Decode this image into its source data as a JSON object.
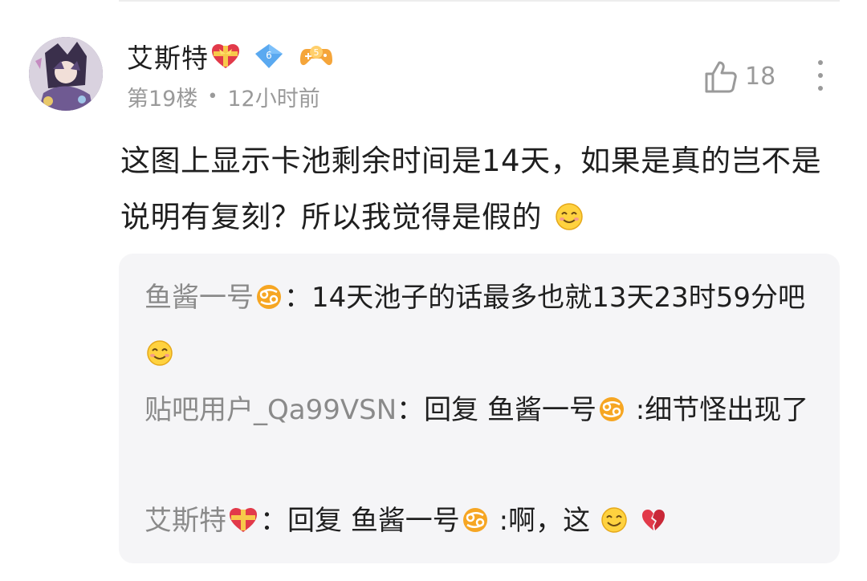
{
  "post": {
    "username": "艾斯特",
    "level": "6",
    "floor": "第19楼",
    "separator": "•",
    "time_ago": "12小时前",
    "like_count": "18",
    "content": "这图上显示卡池剩余时间是14天，如果是真的岂不是说明有复刻？所以我觉得是假的"
  },
  "replies": [
    {
      "name": "鱼酱一号",
      "colon": "：",
      "text": "14天池子的话最多也就13天23时59分吧"
    },
    {
      "name": "贴吧用户_Qa99VSN",
      "colon": "：",
      "prefix": "回复 ",
      "target": "鱼酱一号",
      "text": " :细节怪出现了"
    },
    {
      "name": "艾斯特",
      "colon": "：",
      "prefix": "回复 ",
      "target": "鱼酱一号",
      "text": " :啊，这"
    }
  ],
  "icons": {
    "heart_badge": "heart-bow-icon",
    "level_badge": "level-diamond-icon",
    "game_badge": "game-controller-icon",
    "like": "thumb-up-icon",
    "more": "more-vertical-icon",
    "emoji": "smile-emoji-icon",
    "cancer": "cancer-zodiac-icon",
    "broken_heart": "broken-heart-icon"
  },
  "colors": {
    "text_primary": "#1f1f1f",
    "text_secondary": "#9a9a9a",
    "reply_bg": "#f5f5f7",
    "heart": "#e23a4a",
    "level_badge": "#5aa9f0",
    "game_badge": "#f5a53a"
  }
}
